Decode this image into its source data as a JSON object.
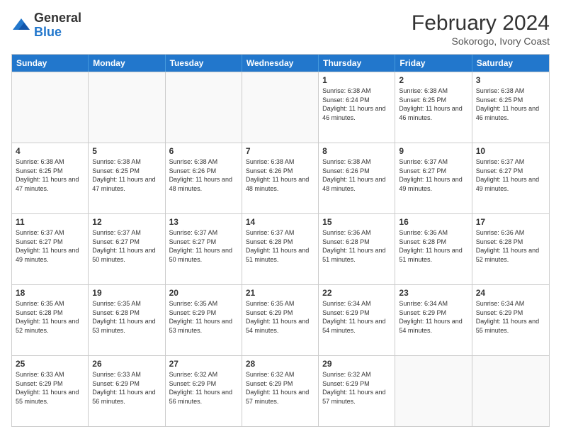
{
  "header": {
    "logo_general": "General",
    "logo_blue": "Blue",
    "main_title": "February 2024",
    "subtitle": "Sokorogo, Ivory Coast"
  },
  "calendar": {
    "days_of_week": [
      "Sunday",
      "Monday",
      "Tuesday",
      "Wednesday",
      "Thursday",
      "Friday",
      "Saturday"
    ],
    "weeks": [
      [
        {
          "day": "",
          "info": ""
        },
        {
          "day": "",
          "info": ""
        },
        {
          "day": "",
          "info": ""
        },
        {
          "day": "",
          "info": ""
        },
        {
          "day": "1",
          "info": "Sunrise: 6:38 AM\nSunset: 6:24 PM\nDaylight: 11 hours and 46 minutes."
        },
        {
          "day": "2",
          "info": "Sunrise: 6:38 AM\nSunset: 6:25 PM\nDaylight: 11 hours and 46 minutes."
        },
        {
          "day": "3",
          "info": "Sunrise: 6:38 AM\nSunset: 6:25 PM\nDaylight: 11 hours and 46 minutes."
        }
      ],
      [
        {
          "day": "4",
          "info": "Sunrise: 6:38 AM\nSunset: 6:25 PM\nDaylight: 11 hours and 47 minutes."
        },
        {
          "day": "5",
          "info": "Sunrise: 6:38 AM\nSunset: 6:25 PM\nDaylight: 11 hours and 47 minutes."
        },
        {
          "day": "6",
          "info": "Sunrise: 6:38 AM\nSunset: 6:26 PM\nDaylight: 11 hours and 48 minutes."
        },
        {
          "day": "7",
          "info": "Sunrise: 6:38 AM\nSunset: 6:26 PM\nDaylight: 11 hours and 48 minutes."
        },
        {
          "day": "8",
          "info": "Sunrise: 6:38 AM\nSunset: 6:26 PM\nDaylight: 11 hours and 48 minutes."
        },
        {
          "day": "9",
          "info": "Sunrise: 6:37 AM\nSunset: 6:27 PM\nDaylight: 11 hours and 49 minutes."
        },
        {
          "day": "10",
          "info": "Sunrise: 6:37 AM\nSunset: 6:27 PM\nDaylight: 11 hours and 49 minutes."
        }
      ],
      [
        {
          "day": "11",
          "info": "Sunrise: 6:37 AM\nSunset: 6:27 PM\nDaylight: 11 hours and 49 minutes."
        },
        {
          "day": "12",
          "info": "Sunrise: 6:37 AM\nSunset: 6:27 PM\nDaylight: 11 hours and 50 minutes."
        },
        {
          "day": "13",
          "info": "Sunrise: 6:37 AM\nSunset: 6:27 PM\nDaylight: 11 hours and 50 minutes."
        },
        {
          "day": "14",
          "info": "Sunrise: 6:37 AM\nSunset: 6:28 PM\nDaylight: 11 hours and 51 minutes."
        },
        {
          "day": "15",
          "info": "Sunrise: 6:36 AM\nSunset: 6:28 PM\nDaylight: 11 hours and 51 minutes."
        },
        {
          "day": "16",
          "info": "Sunrise: 6:36 AM\nSunset: 6:28 PM\nDaylight: 11 hours and 51 minutes."
        },
        {
          "day": "17",
          "info": "Sunrise: 6:36 AM\nSunset: 6:28 PM\nDaylight: 11 hours and 52 minutes."
        }
      ],
      [
        {
          "day": "18",
          "info": "Sunrise: 6:35 AM\nSunset: 6:28 PM\nDaylight: 11 hours and 52 minutes."
        },
        {
          "day": "19",
          "info": "Sunrise: 6:35 AM\nSunset: 6:28 PM\nDaylight: 11 hours and 53 minutes."
        },
        {
          "day": "20",
          "info": "Sunrise: 6:35 AM\nSunset: 6:29 PM\nDaylight: 11 hours and 53 minutes."
        },
        {
          "day": "21",
          "info": "Sunrise: 6:35 AM\nSunset: 6:29 PM\nDaylight: 11 hours and 54 minutes."
        },
        {
          "day": "22",
          "info": "Sunrise: 6:34 AM\nSunset: 6:29 PM\nDaylight: 11 hours and 54 minutes."
        },
        {
          "day": "23",
          "info": "Sunrise: 6:34 AM\nSunset: 6:29 PM\nDaylight: 11 hours and 54 minutes."
        },
        {
          "day": "24",
          "info": "Sunrise: 6:34 AM\nSunset: 6:29 PM\nDaylight: 11 hours and 55 minutes."
        }
      ],
      [
        {
          "day": "25",
          "info": "Sunrise: 6:33 AM\nSunset: 6:29 PM\nDaylight: 11 hours and 55 minutes."
        },
        {
          "day": "26",
          "info": "Sunrise: 6:33 AM\nSunset: 6:29 PM\nDaylight: 11 hours and 56 minutes."
        },
        {
          "day": "27",
          "info": "Sunrise: 6:32 AM\nSunset: 6:29 PM\nDaylight: 11 hours and 56 minutes."
        },
        {
          "day": "28",
          "info": "Sunrise: 6:32 AM\nSunset: 6:29 PM\nDaylight: 11 hours and 57 minutes."
        },
        {
          "day": "29",
          "info": "Sunrise: 6:32 AM\nSunset: 6:29 PM\nDaylight: 11 hours and 57 minutes."
        },
        {
          "day": "",
          "info": ""
        },
        {
          "day": "",
          "info": ""
        }
      ]
    ]
  }
}
